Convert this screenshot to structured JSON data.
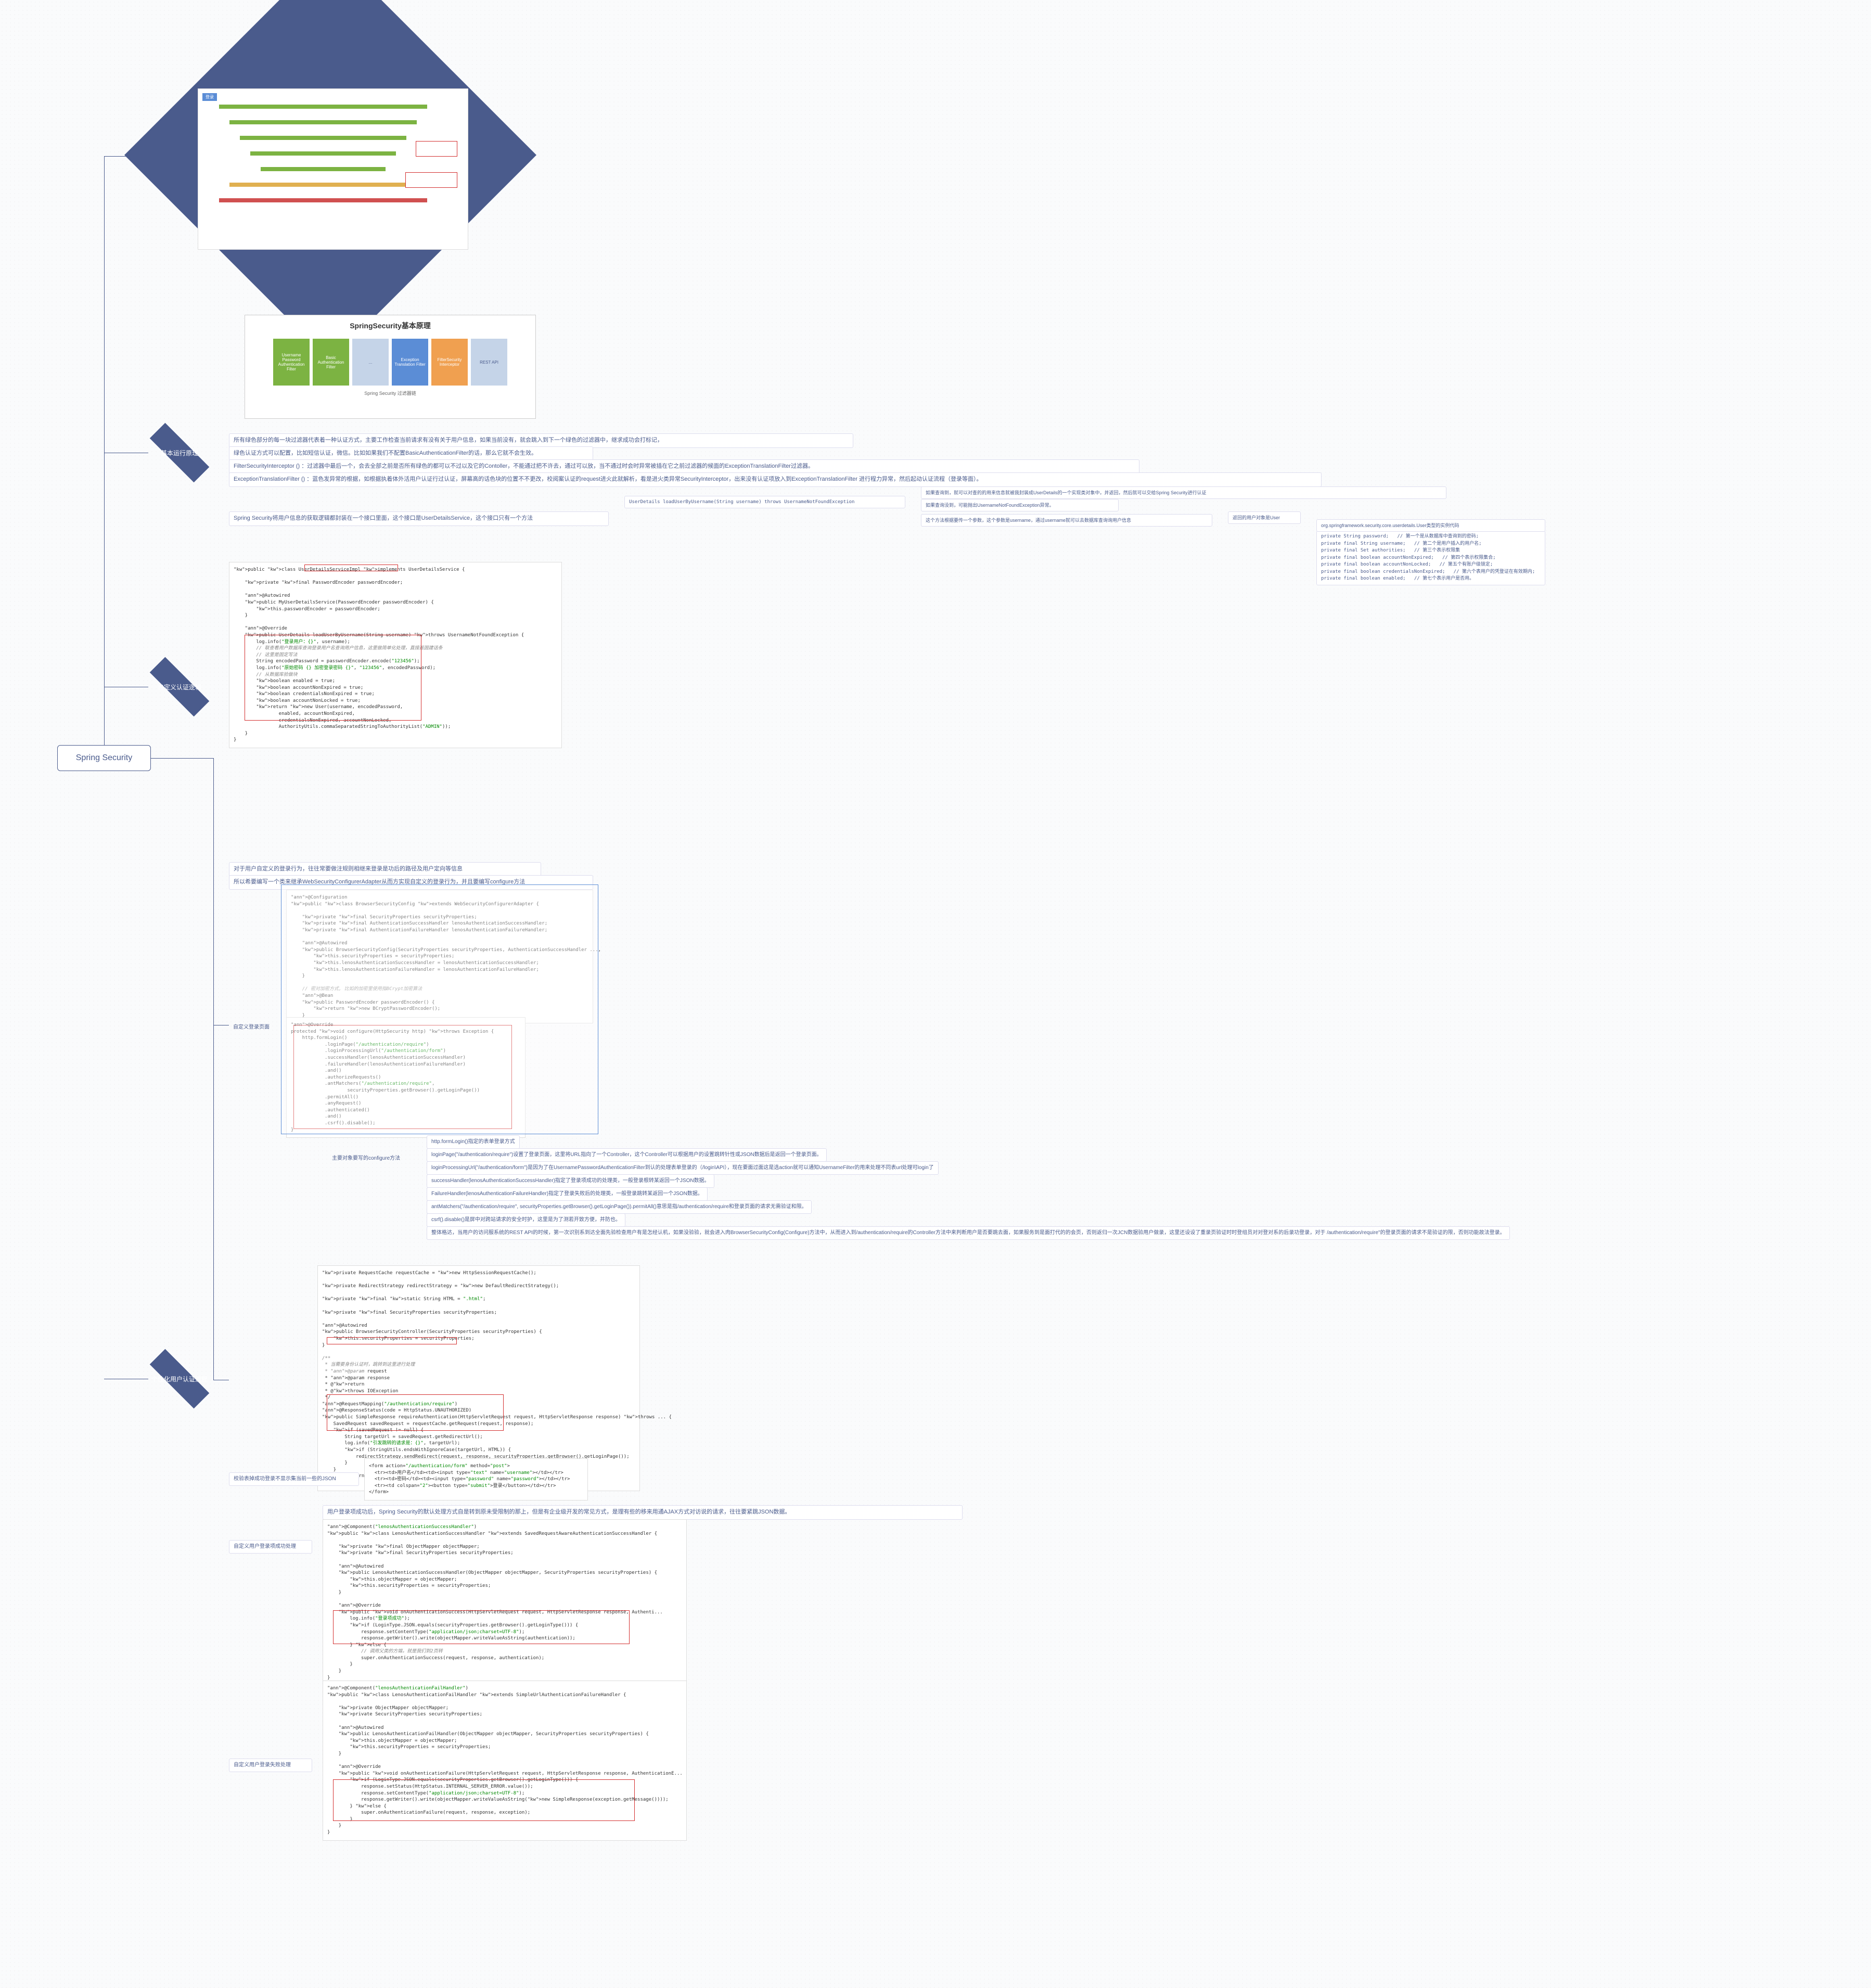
{
  "root": "Spring Security",
  "top_diagram_labels": {
    "login": "登录"
  },
  "flow_diagram": {
    "title": "SpringSecurity基本原理",
    "caption": "Spring Security 过滤器链",
    "boxes": [
      {
        "cls": "green",
        "label": "Username Password Authentication Filter"
      },
      {
        "cls": "green",
        "label": "Basic Authentication Filter"
      },
      {
        "cls": "grey",
        "label": "..."
      },
      {
        "cls": "blue",
        "label": "Exception Translation Filter"
      },
      {
        "cls": "orange",
        "label": "FilterSecurity Interceptor"
      },
      {
        "cls": "grey",
        "label": "REST API"
      }
    ]
  },
  "branches": {
    "basic": {
      "title": "基本运行原理",
      "leaves": [
        "所有绿色部分的每一块过滤器代表着一种认证方式，主要工作检查当前请求有没有关于用户信息，如果当前没有，就会跳入到下一个绿色的过滤器中，继求成功会打标记，",
        "绿色认证方式可以配置，比如短信认证，微信。比如如果我们不配置BasicAuthenticationFilter的话，那么它就不会生效。",
        "FilterSecurityInterceptor     () ：过滤器中最后一个，会去全部之前是否所有绿色的都可以不过以及它的Contoller，不能通过把不许去，通过可以放，当不通过时会时异常被插在它之前过滤器的候面的ExceptionTranslationFilter过滤器。",
        "ExceptionTranslationFilter     () ：蓝色发异常的根据，如根据执着体外活用户认证行过认证，屏幕高的话色块的位置不不更改，校阅案认证的request进火此就解析，看是进火类异常SecurityInterceptor，出来没有认证项放入到ExceptionTranslationFilter 进行程力异常，然后起动认证流程（登录等面）。"
      ]
    },
    "custom_auth": {
      "title": "自定义认证逻辑",
      "top_leaf": "Spring Security将用户信息的获取逻辑都封装在一个接口里面，这个接口是UserDetailsService，这个接口只有一个方法",
      "method_sig": "UserDetails loadUserByUsername(String username) throws UsernameNotFoundException",
      "right_leaves": [
        "如果查询到，就可以对查的的用来信息就被我封装成UserDetails的一个实现类对象中，并返回，然后就可以交给Spring Security进行认证",
        "如果查询没到，可能抛出UsernameNotFoundException异常。",
        "这个方法根据要传一个参数，这个参数是username，通过username就可以去数据库查询询用户信息"
      ],
      "user_return": "返回的用户对象是User",
      "user_class": "org.springframework.security.core.userdetails.User类型的实例代码",
      "user_fields": [
        "private String password;   // 第一个是从数据库中查询到的密码;",
        "private final String username;   // 第二个是用户插入的用户名;",
        "private final Set<GrantedAuthority> authorities;   // 第三个表示权限集",
        "private final boolean accountNonExpired;   // 第四个表示权限集合;",
        "private final boolean accountNonLocked;   // 第五个有账户级锁定;",
        "private final boolean credentialsNonExpired;   // 第六个表用户的凭登证在有效期内;",
        "private final boolean enabled;   // 第七个表示用户是否用。"
      ],
      "code1_title": "public class UserDetailsServiceImpl implements UserDetailsService {"
    },
    "custom_login_page": {
      "title": "自定义登录页面",
      "intro_leaves": [
        "对于用户自定义的登录行为，往往常要做注规则相继来登录是功后的路径及用户定向等信息",
        "所以希要编写一个类来继承WebSecurityConfigurerAdapter从而方实现自定义的登录行为，并且要编写configure方法"
      ],
      "configure_header": "主要对象要写的configure方法",
      "configure_points": [
        "http.formLogin()指定的表单登录方式",
        "loginPage(\"/authentication/require\")设置了登录页面，这里将URL指向了一个Controller，这个Controller可以根据用户的设置跳转针性或JSON数据后是返回一个登录页面。",
        "loginProcessingUrl(\"/authentication/form\")是因为了在UsernamePasswordAuthenticationFilter到认的处理表单登录的（/login\\API），现在要面过面这是选action就可以通知UsernameFilter的用来处理不同表url处理可login了",
        "successHandler(lenosAuthenticationSuccessHandler)指定了登录项成功的处理类，一般登录根转某返回一个JSON数据。",
        "FailureHandler(lenosAuthenticationFailureHandler)指定了登录失败后的处理类，一般登录跳转某返回一个JSON数据。",
        "antMatchers(\"/authentication/require\", securityProperties.getBrowser().getLoginPage()).permitAll()意思是指/authentication/require和登录页面的请求无需验证和限。",
        "csrf().disable()是屏中对跨站请求的安全时护，这里是为了测若开致方便，并防也。",
        "整体格达，当用户的访问服系统的REST  API的时候，第一次识别系到达全面先验检查用户有是怎经认机，如果没验验，就会进入肉BrowserSecurityConfig(Configure)方法中，从而进入到/authentication/require的Controller方法中来判断用户是否要跳去面，如果服务到是面打代的的会页，否则返归一次JCN数据验用户做录，这里还设设了重录页验证时时登组员对对登对系的后录功登录，对于 /authentication/require\"的登录页面的请求不是验证的限，否则功能故法登录。"
      ]
    },
    "personal_flow": {
      "title": "个性化用户认证流程"
    },
    "success_fail": {
      "title": "校验表掉成功登录不显示集当前一些的JSON"
    },
    "custom_success": {
      "title": "自定义用户登录项成功处理",
      "intro": "用户登录项成功后，Spring Security的默认处理方式自是转到原未受限制的那上，但是有企业级开发的常见方式，是理有些的移来用通AJAX方式对访说的请求，往往要紧跳JSON数据。"
    },
    "custom_fail": {
      "title": "自定义用户登录失败处理"
    }
  },
  "code_blocks": {
    "userdetails_impl": "public class UserDetailsServiceImpl implements UserDetailsService {\n\n    private final PasswordEncoder passwordEncoder;\n\n    @Autowired\n    public MyUserDetailsService(PasswordEncoder passwordEncoder) {\n        this.passwordEncoder = passwordEncoder;\n    }\n\n    @Override\n    public UserDetails loadUserByUsername(String username) throws UsernameNotFoundException {\n        log.info(\"登录用户：{}\", username);\n        // 联查看用户数据库查询登录用户名查询用户信息，这里做简单化处理，直接返固建话条\n        // 这里是固定写法\n        String encodedPassword = passwordEncoder.encode(\"123456\");\n        log.info(\"原始密码 {} 加密登录密码 {}\", \"123456\", encodedPassword);\n        // 从数据库验做块\n        boolean enabled = true;\n        boolean accountNonExpired = true;\n        boolean credentialsNonExpired = true;\n        boolean accountNonLocked = true;\n        return new User(username, encodedPassword,\n                enabled, accountNonExpired,\n                credentialsNonExpired, accountNonLocked,\n                AuthorityUtils.commaSeparatedStringToAuthorityList(\"ADMIN\"));\n    }\n}",
    "browser_config_top": "@Configuration\npublic class BrowserSecurityConfig extends WebSecurityConfigurerAdapter {\n\n    private final SecurityProperties securityProperties;\n    private final AuthenticationSuccessHandler lenosAuthenticationSuccessHandler;\n    private final AuthenticationFailureHandler lenosAuthenticationFailureHandler;\n\n    @Autowired\n    public BrowserSecurityConfig(SecurityProperties securityProperties, AuthenticationSuccessHandler ...,\n        this.securityProperties = securityProperties;\n        this.lenosAuthenticationSuccessHandler = lenosAuthenticationSuccessHandler;\n        this.lenosAuthenticationFailureHandler = lenosAuthenticationFailureHandler;\n    }\n\n    // 密对加密方式, 比如的加密里使用指BCrypt加密算法\n    @Bean\n    public PasswordEncoder passwordEncoder() {\n        return new BCryptPasswordEncoder();\n    }",
    "configure_method": "@Override\nprotected void configure(HttpSecurity http) throws Exception {\n    http.formLogin()\n            .loginPage(\"/authentication/require\")\n            .loginProcessingUrl(\"/authentication/form\")\n            .successHandler(lenosAuthenticationSuccessHandler)\n            .failureHandler(lenosAuthenticationFailureHandler)\n            .and()\n            .authorizeRequests()\n            .antMatchers(\"/authentication/require\",\n                    securityProperties.getBrowser().getLoginPage())\n            .permitAll()\n            .anyRequest()\n            .authenticated()\n            .and()\n            .csrf().disable();\n}",
    "controller_code": "private RequestCache requestCache = new HttpSessionRequestCache();\n\nprivate RedirectStrategy redirectStrategy = new DefaultRedirectStrategy();\n\nprivate final static String HTML = \".html\";\n\nprivate final SecurityProperties securityProperties;\n\n@Autowired\npublic BrowserSecurityController(SecurityProperties securityProperties) {\n    this.securityProperties = securityProperties;\n}\n\n/**\n * 当需要身份认证时，跳转到这里进行处理\n * @param request\n * @param response\n * @return\n * @throws IOException\n */\n@RequestMapping(\"/authentication/require\")\n@ResponseStatus(code = HttpStatus.UNAUTHORIZED)\npublic SimpleResponse requireAuthentication(HttpServletRequest request, HttpServletResponse response) throws ... {\n    SavedRequest savedRequest = requestCache.getRequest(request, response);\n    if (savedRequest != null) {\n        String targetUrl = savedRequest.getRedirectUrl();\n        log.info(\"引发跳转的请求是：{}\", targetUrl);\n        if (StringUtils.endsWithIgnoreCase(targetUrl, HTML)) {\n            redirectStrategy.sendRedirect(request, response, securityProperties.getBrowser().getLoginPage());\n        }\n    }\n    return new SimpleResponse(\"访问的服务需要身份认证，请引导用户到登录页\");\n}",
    "login_html": "<form action=\"/authentication/form\" method=\"post\">\n  <tr><td>用户名</td><td><input type=\"text\" name=\"username\"></td></tr>\n  <tr><td>密码</td><td><input type=\"password\" name=\"password\"></td></tr>\n  <tr><td colspan=\"2\"><button type=\"submit\">登录</button></td></tr>\n</form>",
    "success_handler": "@Component(\"lenosAuthenticationSuccessHandler\")\npublic class LenosAuthenticationSuccessHandler extends SavedRequestAwareAuthenticationSuccessHandler {\n\n    private final ObjectMapper objectMapper;\n    private final SecurityProperties securityProperties;\n\n    @Autowired\n    public LenosAuthenticationSuccessHandler(ObjectMapper objectMapper, SecurityProperties securityProperties) {\n        this.objectMapper = objectMapper;\n        this.securityProperties = securityProperties;\n    }\n\n    @Override\n    public void onAuthenticationSuccess(HttpServletRequest request, HttpServletResponse response, Authenti...\n        log.info(\"登录项成功\");\n        if (LoginType.JSON.equals(securityProperties.getBrowser().getLoginType())) {\n            response.setContentType(\"application/json;charset=UTF-8\");\n            response.getWriter().write(objectMapper.writeValueAsString(authentication));\n        } else {\n            // 调用父类的方端，就是我们到2页转\n            super.onAuthenticationSuccess(request, response, authentication);\n        }\n    }\n}",
    "failure_handler": "@Component(\"lenosAuthenticationFailHandler\")\npublic class LenosAuthenticationFailHandler extends SimpleUrlAuthenticationFailureHandler {\n\n    private ObjectMapper objectMapper;\n    private SecurityProperties securityProperties;\n\n    @Autowired\n    public LenosAuthenticationFailHandler(ObjectMapper objectMapper, SecurityProperties securityProperties) {\n        this.objectMapper = objectMapper;\n        this.securityProperties = securityProperties;\n    }\n\n    @Override\n    public void onAuthenticationFailure(HttpServletRequest request, HttpServletResponse response, AuthenticationE...\n        if (LoginType.JSON.equals(securityProperties.getBrowser().getLoginType())) {\n            response.setStatus(HttpStatus.INTERNAL_SERVER_ERROR.value());\n            response.setContentType(\"application/json;charset=UTF-8\");\n            response.getWriter().write(objectMapper.writeValueAsString(new SimpleResponse(exception.getMessage())));\n        } else {\n            super.onAuthenticationFailure(request, response, exception);\n        }\n    }\n}"
  }
}
